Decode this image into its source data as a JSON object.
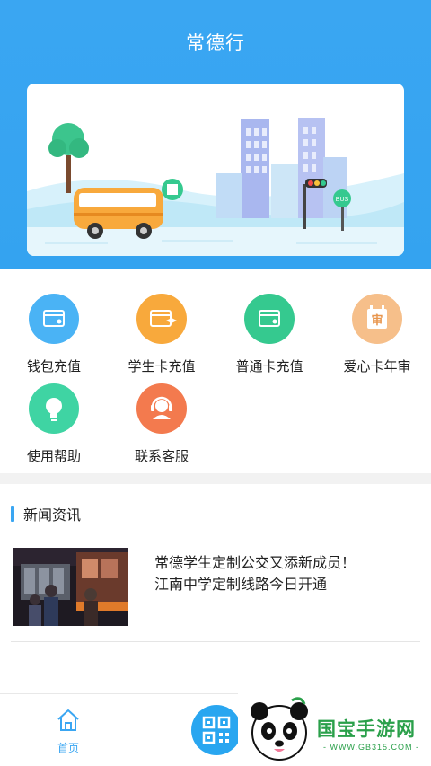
{
  "header": {
    "title": "常德行"
  },
  "services": [
    {
      "label": "钱包充值",
      "icon": "wallet-card-icon",
      "color": "#4ab3f5"
    },
    {
      "label": "学生卡充值",
      "icon": "student-card-icon",
      "color": "#f8a93c"
    },
    {
      "label": "普通卡充值",
      "icon": "card-icon",
      "color": "#35c98f"
    },
    {
      "label": "爱心卡年审",
      "icon": "calendar-review-icon",
      "color": "#f6bf8a",
      "glyph": "审"
    },
    {
      "label": "使用帮助",
      "icon": "lightbulb-icon",
      "color": "#3fd4a3"
    },
    {
      "label": "联系客服",
      "icon": "headset-icon",
      "color": "#f37a4e"
    }
  ],
  "news": {
    "section_title": "新闻资讯",
    "items": [
      {
        "line1": "常德学生定制公交又添新成员！",
        "line2": "江南中学定制线路今日开通"
      }
    ]
  },
  "tabbar": {
    "home_label": "首页",
    "qr_icon": "qr-code-icon"
  },
  "watermark": {
    "text": "国宝手游网",
    "url": "- WWW.GB315.COM -"
  },
  "banner": {
    "bus_sign": "BUS"
  }
}
